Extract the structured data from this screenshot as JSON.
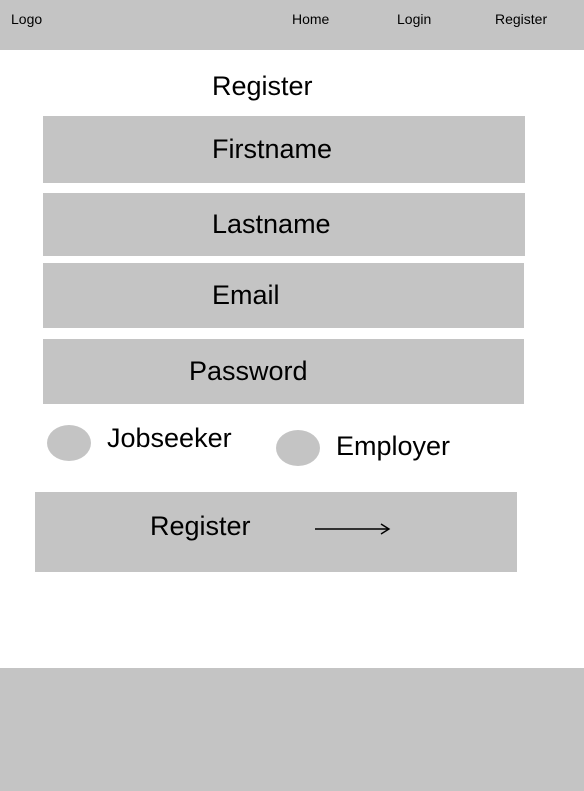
{
  "header": {
    "logo": "Logo",
    "nav": {
      "home": "Home",
      "login": "Login",
      "register": "Register"
    }
  },
  "form": {
    "title": "Register",
    "fields": {
      "firstname": "Firstname",
      "lastname": "Lastname",
      "email": "Email",
      "password": "Password"
    },
    "roles": {
      "jobseeker": "Jobseeker",
      "employer": "Employer"
    },
    "submit_label": "Register",
    "submit_icon": "arrow-right-icon"
  },
  "colors": {
    "block_fill": "#c4c4c4",
    "background": "#ffffff",
    "text": "#000000"
  }
}
